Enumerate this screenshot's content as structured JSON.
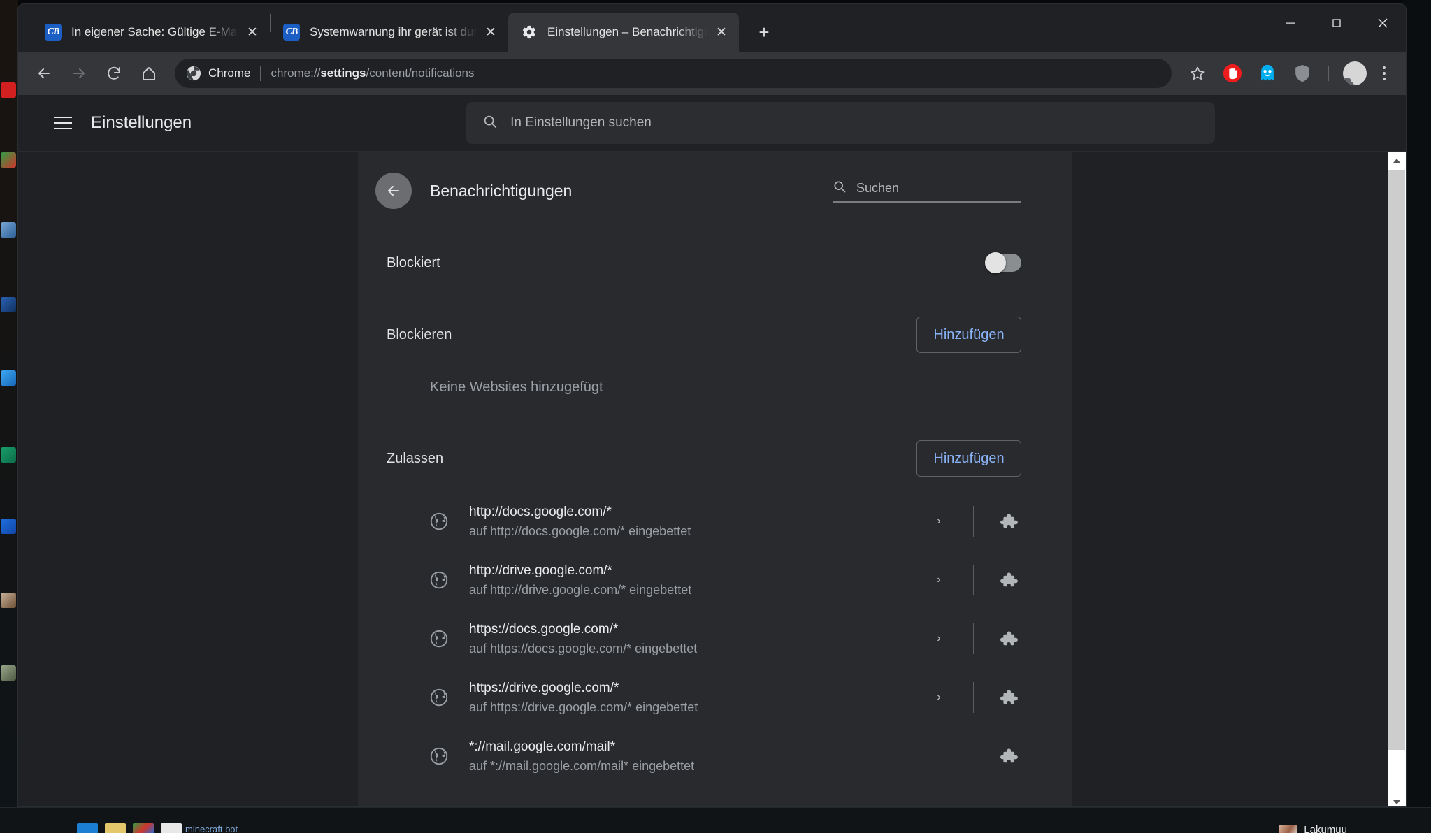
{
  "window": {
    "controls": {
      "minimize": "Minimieren",
      "maximize": "Maximieren",
      "close": "Schließen"
    }
  },
  "tabs": [
    {
      "favicon": "computerbase-icon",
      "favicon_text": "CB",
      "title": "In eigener Sache: Gültige E-Mail-",
      "close_label": "✕",
      "active": false
    },
    {
      "favicon": "computerbase-icon",
      "favicon_text": "CB",
      "title": "Systemwarnung ihr gerät ist durc",
      "close_label": "✕",
      "active": false
    },
    {
      "favicon": "settings-gear-icon",
      "favicon_text": "",
      "title": "Einstellungen – Benachrichtigung",
      "close_label": "✕",
      "active": true
    }
  ],
  "new_tab_label": "+",
  "toolbar": {
    "back_label": "Zurück",
    "forward_label": "Vorwärts",
    "reload_label": "Neu laden",
    "home_label": "Startseite",
    "omnibox": {
      "chrome_label": "Chrome",
      "url_prefix": "chrome://",
      "url_bold": "settings",
      "url_suffix": "/content/notifications"
    },
    "bookmark_label": "Lesezeichen",
    "extensions": [
      {
        "name": "adblock-icon",
        "color": "#ee1d1d"
      },
      {
        "name": "ghostery-icon",
        "color": "#00aef0"
      },
      {
        "name": "shield-icon",
        "color": "#8a8d91"
      }
    ],
    "profile_label": "Profil",
    "menu_label": "Mehr"
  },
  "settings": {
    "title": "Einstellungen",
    "search_placeholder": "In Einstellungen suchen",
    "menu_label": "Hauptmenü"
  },
  "main": {
    "back_label": "Zurück",
    "page_title": "Benachrichtigungen",
    "inline_search_placeholder": "Suchen",
    "blocked_row": {
      "label": "Blockiert",
      "toggle_state": "off"
    },
    "block_section": {
      "title": "Blockieren",
      "add_label": "Hinzufügen",
      "empty_text": "Keine Websites hinzugefügt"
    },
    "allow_section": {
      "title": "Zulassen",
      "add_label": "Hinzufügen",
      "items": [
        {
          "url": "http://docs.google.com/*",
          "sub": "auf http://docs.google.com/* eingebettet",
          "chevron": "›",
          "has_chevron": true,
          "has_divider": true
        },
        {
          "url": "http://drive.google.com/*",
          "sub": "auf http://drive.google.com/* eingebettet",
          "chevron": "›",
          "has_chevron": true,
          "has_divider": true
        },
        {
          "url": "https://docs.google.com/*",
          "sub": "auf https://docs.google.com/* eingebettet",
          "chevron": "›",
          "has_chevron": true,
          "has_divider": true
        },
        {
          "url": "https://drive.google.com/*",
          "sub": "auf https://drive.google.com/* eingebettet",
          "chevron": "›",
          "has_chevron": true,
          "has_divider": true
        },
        {
          "url": "*://mail.google.com/mail*",
          "sub": "auf *://mail.google.com/mail* eingebettet",
          "chevron": "›",
          "has_chevron": false,
          "has_divider": false
        }
      ]
    }
  },
  "taskbar": {
    "items": [
      {
        "label": "",
        "color": "#1b7fd4"
      },
      {
        "label": "",
        "color": "#e5c76b"
      },
      {
        "label": "",
        "color": "#2f9e44"
      }
    ],
    "app_text": "minecraft bot",
    "user_name": "Lakumuu"
  },
  "colors": {
    "accent_blue": "#8ab4f8",
    "tab_active_bg": "#35363a",
    "window_bg": "#202124",
    "card_bg": "#292a2d"
  }
}
